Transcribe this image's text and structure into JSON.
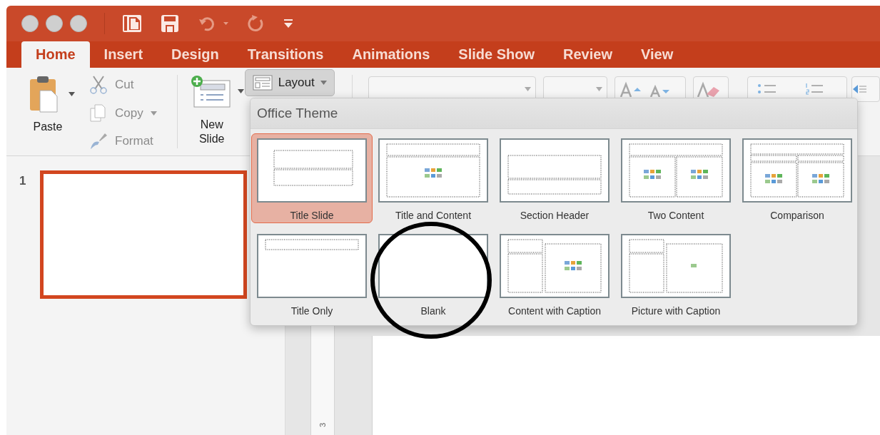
{
  "tabs": [
    {
      "label": "Home",
      "selected": true
    },
    {
      "label": "Insert",
      "selected": false
    },
    {
      "label": "Design",
      "selected": false
    },
    {
      "label": "Transitions",
      "selected": false
    },
    {
      "label": "Animations",
      "selected": false
    },
    {
      "label": "Slide Show",
      "selected": false
    },
    {
      "label": "Review",
      "selected": false
    },
    {
      "label": "View",
      "selected": false
    }
  ],
  "clipboard": {
    "paste": "Paste",
    "actions": [
      {
        "label": "Cut",
        "kind": "cut",
        "disabled": true
      },
      {
        "label": "Copy",
        "kind": "copy",
        "disabled": true
      },
      {
        "label": "Format",
        "kind": "format",
        "disabled": true
      }
    ]
  },
  "new_slide": {
    "label": "New Slide"
  },
  "layout_button": {
    "label": "Layout",
    "expanded": true
  },
  "layout_menu": {
    "title": "Office Theme",
    "layouts": [
      {
        "label": "Title Slide",
        "kind": "title-slide",
        "selected": true
      },
      {
        "label": "Title and Content",
        "kind": "title-content",
        "selected": false
      },
      {
        "label": "Section Header",
        "kind": "section-header",
        "selected": false
      },
      {
        "label": "Two Content",
        "kind": "two-content",
        "selected": false
      },
      {
        "label": "Comparison",
        "kind": "comparison",
        "selected": false
      },
      {
        "label": "Title Only",
        "kind": "title-only",
        "selected": false
      },
      {
        "label": "Blank",
        "kind": "blank",
        "selected": false
      },
      {
        "label": "Content with Caption",
        "kind": "content-caption",
        "selected": false
      },
      {
        "label": "Picture with Caption",
        "kind": "picture-caption",
        "selected": false
      }
    ]
  },
  "slides": [
    {
      "number": "1",
      "selected": true
    }
  ],
  "ruler": {
    "label": "3"
  }
}
